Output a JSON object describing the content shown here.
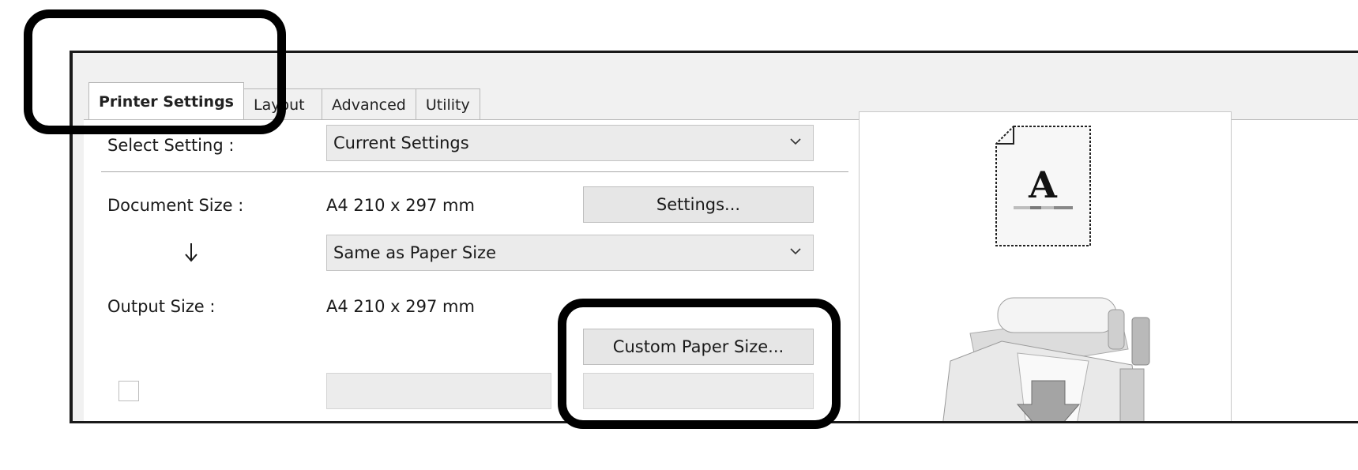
{
  "tabs": [
    {
      "label": "Printer Settings",
      "active": true
    },
    {
      "label": "Layout",
      "active": false
    },
    {
      "label": "Advanced",
      "active": false
    },
    {
      "label": "Utility",
      "active": false
    }
  ],
  "select_setting": {
    "label": "Select Setting :",
    "value": "Current Settings"
  },
  "document_size": {
    "label": "Document Size :",
    "value": "A4 210 x 297 mm",
    "settings_button": "Settings..."
  },
  "scaling": {
    "arrow": "down-arrow-icon",
    "value": "Same as Paper Size"
  },
  "output_size": {
    "label": "Output Size :",
    "value": "A4 210 x 297 mm",
    "custom_button": "Custom Paper Size..."
  },
  "preview": {
    "letter": "A"
  },
  "icons": [
    "chevron-down-icon",
    "down-arrow-icon",
    "document-icon",
    "printer-icon"
  ]
}
